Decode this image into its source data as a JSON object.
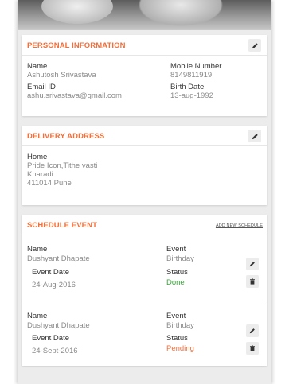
{
  "personal": {
    "title": "PERSONAL INFORMATION",
    "name_label": "Name",
    "name_value": "Ashutosh Srivastava",
    "mobile_label": "Mobile Number",
    "mobile_value": "8149811919",
    "email_label": "Email ID",
    "email_value": "ashu.srivastava@gmail.com",
    "birth_label": "Birth Date",
    "birth_value": "13-aug-1992"
  },
  "delivery": {
    "title": "DELIVERY ADDRESS",
    "label": "Home",
    "line1": "Pride Icon,Tithe vasti",
    "line2": "Kharadi",
    "line3": "411014 Pune"
  },
  "schedule": {
    "title": "SCHEDULE  EVENT",
    "add_link": "ADD NEW SCHEDULE",
    "events": [
      {
        "name_label": "Name",
        "name_value": "Dushyant Dhapate",
        "event_label": "Event",
        "event_value": "Birthday",
        "date_label": "Event Date",
        "date_value": "24-Aug-2016",
        "status_label": "Status",
        "status_value": "Done"
      },
      {
        "name_label": "Name",
        "name_value": "Dushyant Dhapate",
        "event_label": "Event",
        "event_value": "Birthday",
        "date_label": "Event Date",
        "date_value": "24-Sept-2016",
        "status_label": "Status",
        "status_value": "Pending"
      }
    ]
  },
  "colors": {
    "accent": "#f0703c",
    "done": "#3aa63a",
    "pending": "#f0703c",
    "background": "#ececec"
  },
  "icons": {
    "edit": "pencil-icon",
    "delete": "trash-icon"
  }
}
